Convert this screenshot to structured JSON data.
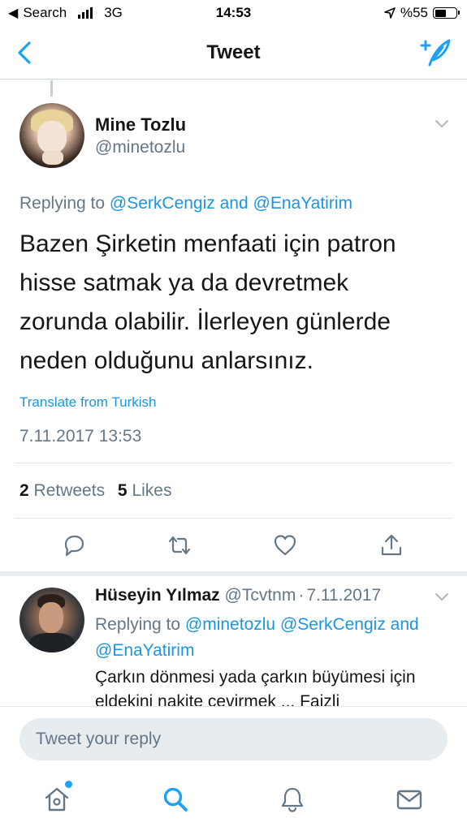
{
  "status_bar": {
    "carrier": "Search",
    "network": "3G",
    "time": "14:53",
    "battery": "%55",
    "battery_level": 0.55
  },
  "nav": {
    "title": "Tweet",
    "back_icon": "back-chevron-icon",
    "compose_icon": "compose-tweet-icon"
  },
  "tweet": {
    "author_name": "Mine Tozlu",
    "author_handle": "@minetozlu",
    "replying_prefix": "Replying to",
    "replying_user1": "@SerkCengiz",
    "replying_and": "and",
    "replying_user2": "@EnaYatirim",
    "text": "Bazen Şirketin menfaati için patron hisse satmak ya da devretmek zorunda olabilir. İlerleyen günlerde neden olduğunu anlarsınız.",
    "translate": "Translate from Turkish",
    "timestamp": "7.11.2017 13:53",
    "retweet_count": "2",
    "retweet_label": "Retweets",
    "like_count": "5",
    "like_label": "Likes",
    "actions": [
      "reply-icon",
      "retweet-icon",
      "like-icon",
      "share-icon"
    ]
  },
  "reply": {
    "author_name": "Hüseyin Yılmaz",
    "author_handle": "@Tcvtnm",
    "separator": "·",
    "date": "7.11.2017",
    "replying_prefix": "Replying to",
    "replying_user1": "@minetozlu",
    "replying_user2": "@SerkCengiz",
    "replying_and": "and",
    "replying_user3": "@EnaYatirim",
    "text": "Çarkın dönmesi yada çarkın büyümesi için eldekini nakite çevirmek ... Faizli"
  },
  "composer": {
    "placeholder": "Tweet your reply"
  },
  "tab_bar": {
    "items": [
      "home-icon",
      "search-icon",
      "notifications-icon",
      "messages-icon"
    ]
  },
  "colors": {
    "accent": "#1da1f2",
    "link": "#1b95e0",
    "secondary_text": "#657786"
  }
}
